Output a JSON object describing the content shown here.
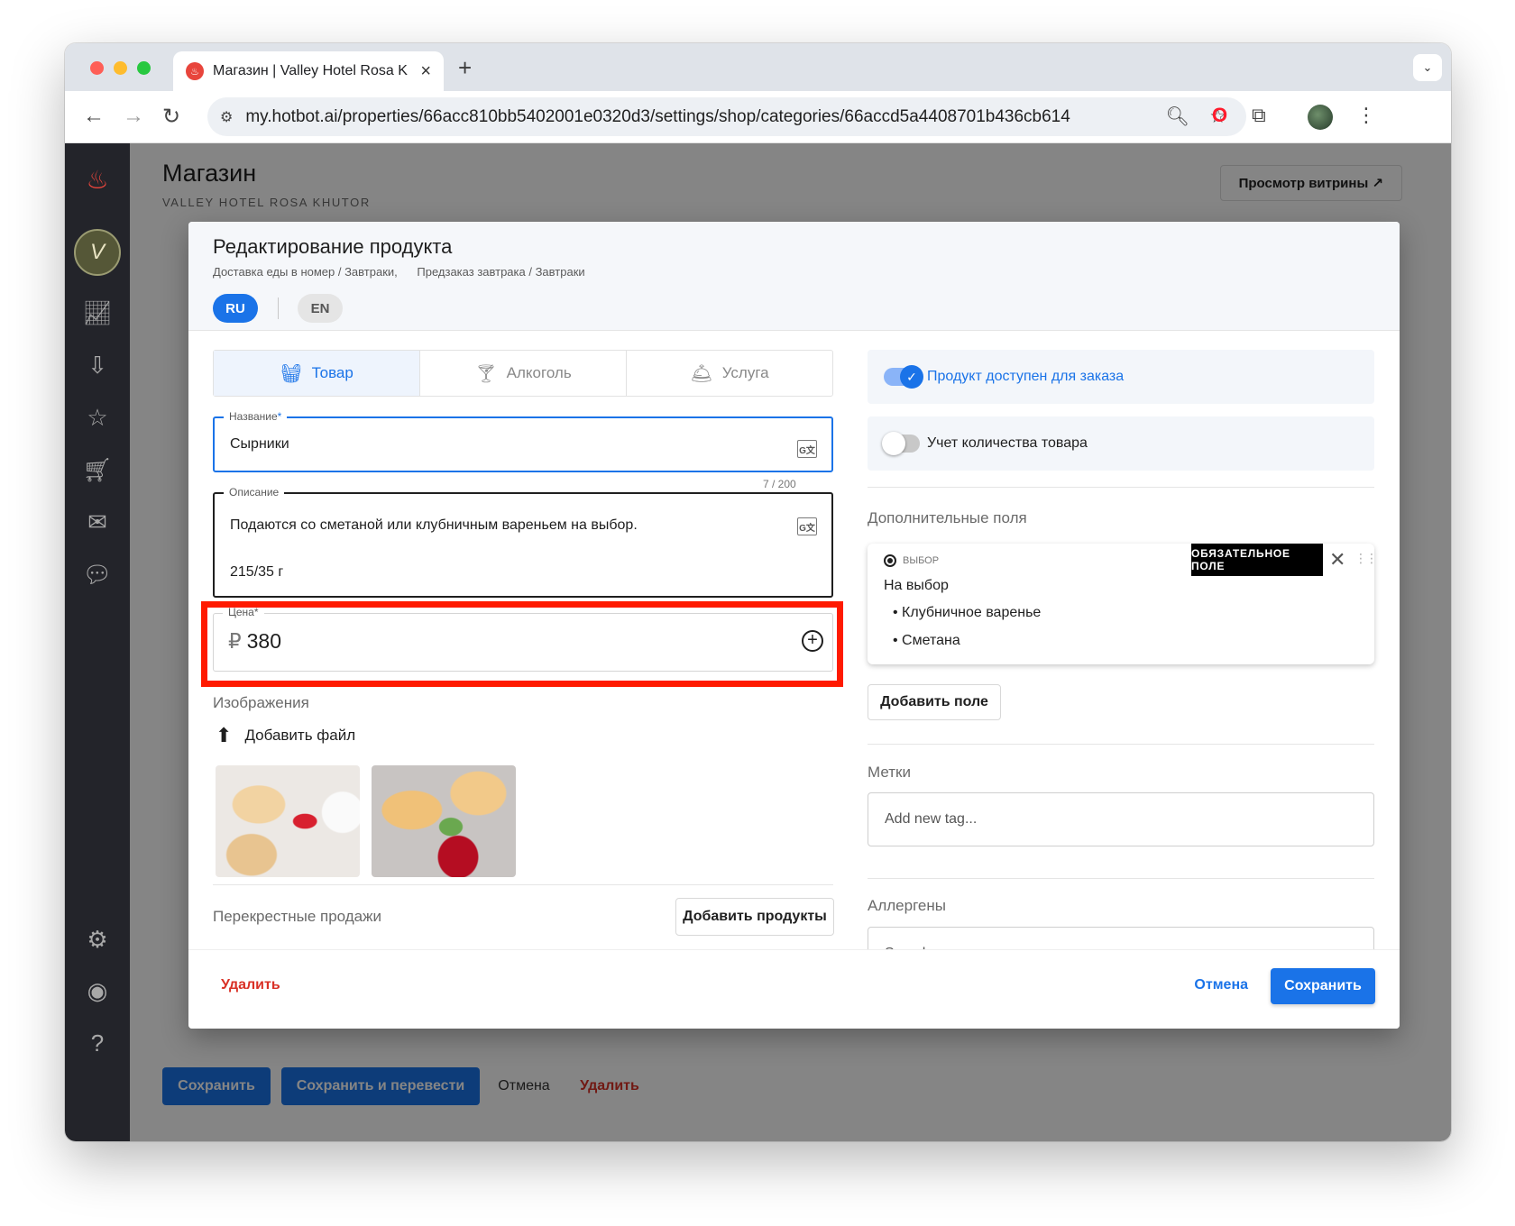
{
  "browser": {
    "tab_title": "Магазин | Valley Hotel Rosa K",
    "tab_close": "×",
    "new_tab": "+",
    "url": "my.hotbot.ai/properties/66acc810bb5402001e0320d3/settings/shop/categories/66accd5a4408701b436cb614"
  },
  "page": {
    "title": "Магазин",
    "subtitle": "VALLEY HOTEL ROSA KHUTOR",
    "storefront_button": "Просмотр витрины ↗",
    "footer": {
      "save": "Сохранить",
      "save_translate": "Сохранить и перевести",
      "cancel": "Отмена",
      "delete": "Удалить"
    }
  },
  "modal": {
    "title": "Редактирование продукта",
    "breadcrumbs": [
      "Доставка еды в номер / Завтраки,",
      "Предзаказ завтрака / Завтраки"
    ],
    "languages": {
      "active": "RU",
      "other": "EN"
    },
    "type_tabs": [
      {
        "label": "Товар",
        "icon": "basket-icon",
        "active": true
      },
      {
        "label": "Алкоголь",
        "icon": "cocktail-icon",
        "active": false
      },
      {
        "label": "Услуга",
        "icon": "service-icon",
        "active": false
      }
    ],
    "name_field": {
      "label": "Название",
      "required_mark": "*",
      "value": "Сырники",
      "counter": "7 / 200"
    },
    "description_field": {
      "label": "Описание",
      "value": "Подаются со сметаной или клубничным вареньем на выбор.\n\n215/35 г"
    },
    "price_field": {
      "label": "Цена",
      "required_mark": "*",
      "currency": "₽",
      "value": "380"
    },
    "images": {
      "label": "Изображения",
      "add_file": "Добавить файл"
    },
    "cross_sales": {
      "label": "Перекрестные продажи",
      "add_products": "Добавить продукты"
    },
    "available_toggle": {
      "label": "Продукт доступен для заказа",
      "on": true
    },
    "stock_toggle": {
      "label": "Учет количества товара",
      "on": false
    },
    "extra_fields": {
      "label": "Дополнительные поля",
      "card": {
        "type": "ВЫБОР",
        "badge": "ОБЯЗАТЕЛЬНОЕ ПОЛЕ",
        "title": "На выбор",
        "options": [
          "• Клубничное варенье",
          "• Сметана"
        ]
      },
      "add_field": "Добавить поле"
    },
    "tags": {
      "label": "Метки",
      "placeholder": "Add new tag..."
    },
    "allergens": {
      "label": "Аллергены",
      "placeholder": "Search..."
    },
    "footer": {
      "delete": "Удалить",
      "cancel": "Отмена",
      "save": "Сохранить"
    }
  },
  "colors": {
    "accent": "#1a73e8",
    "danger": "#d93025",
    "highlight": "#ff1a00",
    "sidebar": "#23242a"
  }
}
